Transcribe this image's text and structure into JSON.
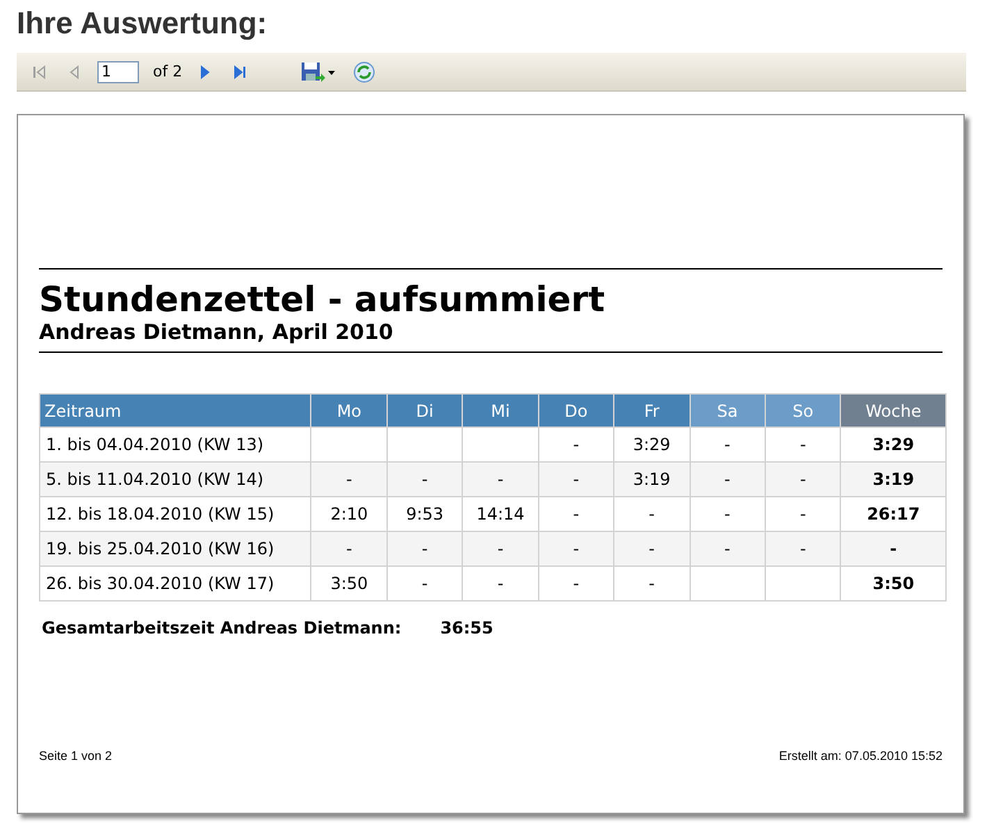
{
  "heading": "Ihre Auswertung:",
  "toolbar": {
    "page": "1",
    "page_count": "of 2",
    "first_disabled": true,
    "prev_disabled": true,
    "next_disabled": false,
    "last_disabled": false
  },
  "report": {
    "title": "Stundenzettel - aufsummiert",
    "subtitle": "Andreas Dietmann, April 2010",
    "table": {
      "columns": [
        {
          "label": "Zeitraum",
          "kind": "period"
        },
        {
          "label": "Mo",
          "kind": "weekday"
        },
        {
          "label": "Di",
          "kind": "weekday"
        },
        {
          "label": "Mi",
          "kind": "weekday"
        },
        {
          "label": "Do",
          "kind": "weekday"
        },
        {
          "label": "Fr",
          "kind": "weekday"
        },
        {
          "label": "Sa",
          "kind": "weekend"
        },
        {
          "label": "So",
          "kind": "weekend"
        },
        {
          "label": "Woche",
          "kind": "total"
        }
      ],
      "rows": [
        [
          "1. bis 04.04.2010 (KW 13)",
          null,
          null,
          null,
          "-",
          "3:29",
          "-",
          "-",
          "3:29"
        ],
        [
          "5. bis 11.04.2010 (KW 14)",
          "-",
          "-",
          "-",
          "-",
          "3:19",
          "-",
          "-",
          "3:19"
        ],
        [
          "12. bis 18.04.2010 (KW 15)",
          "2:10",
          "9:53",
          "14:14",
          "-",
          "-",
          "-",
          "-",
          "26:17"
        ],
        [
          "19. bis 25.04.2010 (KW 16)",
          "-",
          "-",
          "-",
          "-",
          "-",
          "-",
          "-",
          "-"
        ],
        [
          "26. bis 30.04.2010 (KW 17)",
          "3:50",
          "-",
          "-",
          "-",
          "-",
          null,
          null,
          "3:50"
        ]
      ]
    },
    "total_label": "Gesamtarbeitszeit Andreas Dietmann:",
    "total_value": "36:55",
    "footer_left": "Seite 1 von 2",
    "footer_right": "Erstellt am: 07.05.2010 15:52"
  }
}
